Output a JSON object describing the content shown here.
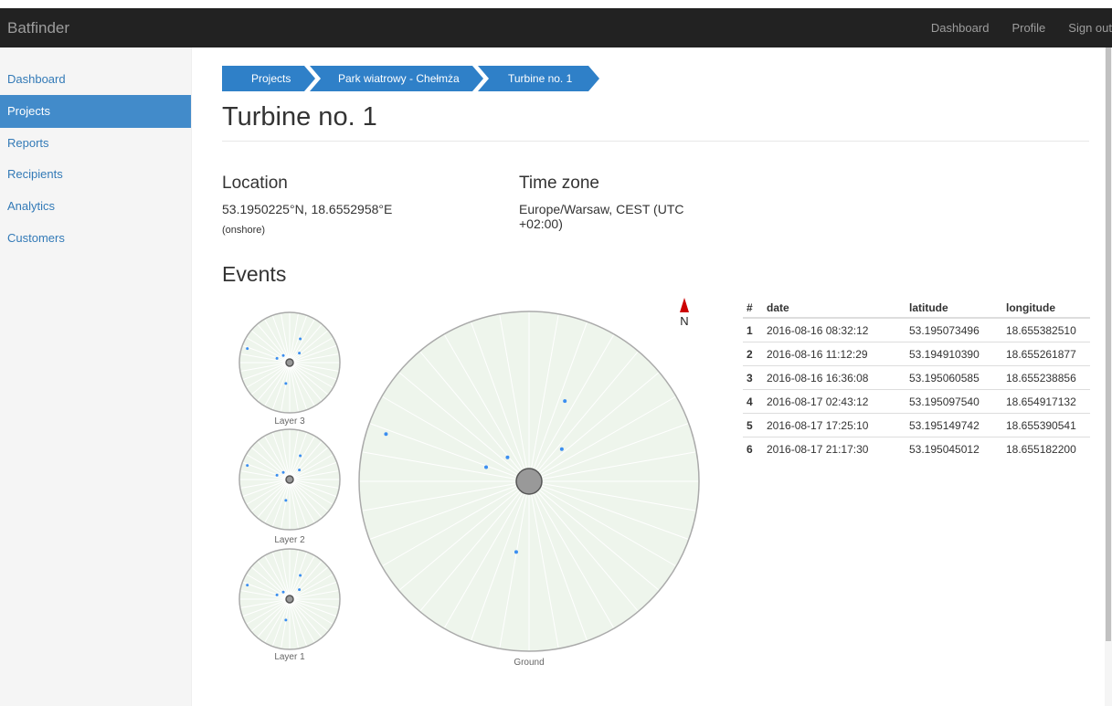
{
  "app": {
    "brand": "Batfinder"
  },
  "nav": {
    "dashboard": "Dashboard",
    "profile": "Profile",
    "signout": "Sign out"
  },
  "sidebar": {
    "items": [
      {
        "label": "Dashboard"
      },
      {
        "label": "Projects",
        "active": true
      },
      {
        "label": "Reports"
      },
      {
        "label": "Recipients"
      },
      {
        "label": "Analytics"
      },
      {
        "label": "Customers"
      }
    ]
  },
  "breadcrumb": [
    "Projects",
    "Park wiatrowy - Chełmża",
    "Turbine no. 1"
  ],
  "page": {
    "title": "Turbine no. 1"
  },
  "location": {
    "heading": "Location",
    "coords": "53.1950225°N, 18.6552958°E",
    "note": "(onshore)"
  },
  "timezone": {
    "heading": "Time zone",
    "line1": "Europe/Warsaw, CEST (UTC",
    "line2": "+02:00)"
  },
  "events": {
    "heading": "Events",
    "compass": "N",
    "layers": [
      "Layer 3",
      "Layer 2",
      "Layer 1"
    ],
    "ground_label": "Ground",
    "columns": [
      "#",
      "date",
      "latitude",
      "longitude"
    ],
    "rows": [
      [
        "1",
        "2016-08-16 08:32:12",
        "53.195073496",
        "18.655382510"
      ],
      [
        "2",
        "2016-08-16 11:12:29",
        "53.194910390",
        "18.655261877"
      ],
      [
        "3",
        "2016-08-16 16:36:08",
        "53.195060585",
        "18.655238856"
      ],
      [
        "4",
        "2016-08-17 02:43:12",
        "53.195097540",
        "18.654917132"
      ],
      [
        "5",
        "2016-08-17 17:25:10",
        "53.195149742",
        "18.655390541"
      ],
      [
        "6",
        "2016-08-17 21:17:30",
        "53.195045012",
        "18.655182200"
      ]
    ]
  },
  "colors": {
    "navbar": "#222222",
    "active": "#428bca",
    "link": "#337ab7",
    "crumb": "#2f80c8",
    "plot_fill": "#eef5ec",
    "point": "#3b8ef0",
    "north": "#cc0000"
  }
}
